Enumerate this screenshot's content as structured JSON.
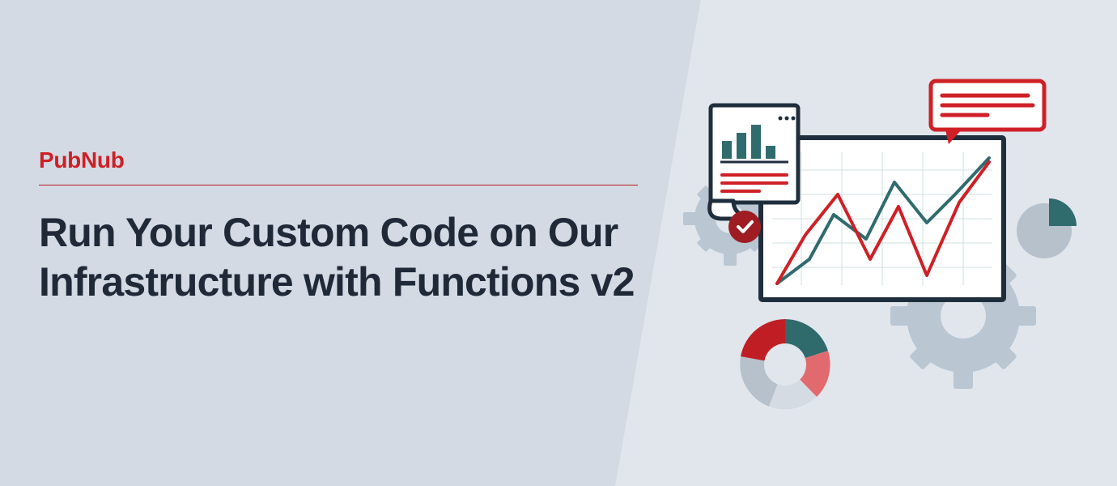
{
  "brand": {
    "name": "PubNub",
    "color": "#ce2026"
  },
  "headline": {
    "text": "Run Your Custom Code on Our Infrastructure with Functions v2",
    "color": "#1f2937"
  },
  "rule_color": "#b91c1c",
  "palette": {
    "bg_left": "#d3dae3",
    "bg_right": "#e0e6ec",
    "dark": "#1f2e3d",
    "red": "#ce2026",
    "teal": "#5f9ea0",
    "teal_dark": "#306b6e",
    "grey": "#b7c1cc",
    "grey_light": "#d4dbe3",
    "white": "#ffffff"
  },
  "illustration": {
    "gears": [
      "gear-large",
      "gear-small"
    ],
    "chart_panel": {
      "series_a": "teal-line",
      "series_b": "red-line",
      "grid": true
    },
    "report_card": {
      "bars": 4,
      "lines": 3
    },
    "check_badge": "checkmark",
    "speech_bubble": {
      "lines": 3
    },
    "pie_small": {
      "slices": [
        "teal_dark",
        "grey"
      ]
    },
    "donut": {
      "segments": [
        "teal_dark",
        "red_light",
        "grey_light",
        "grey",
        "red"
      ]
    }
  }
}
